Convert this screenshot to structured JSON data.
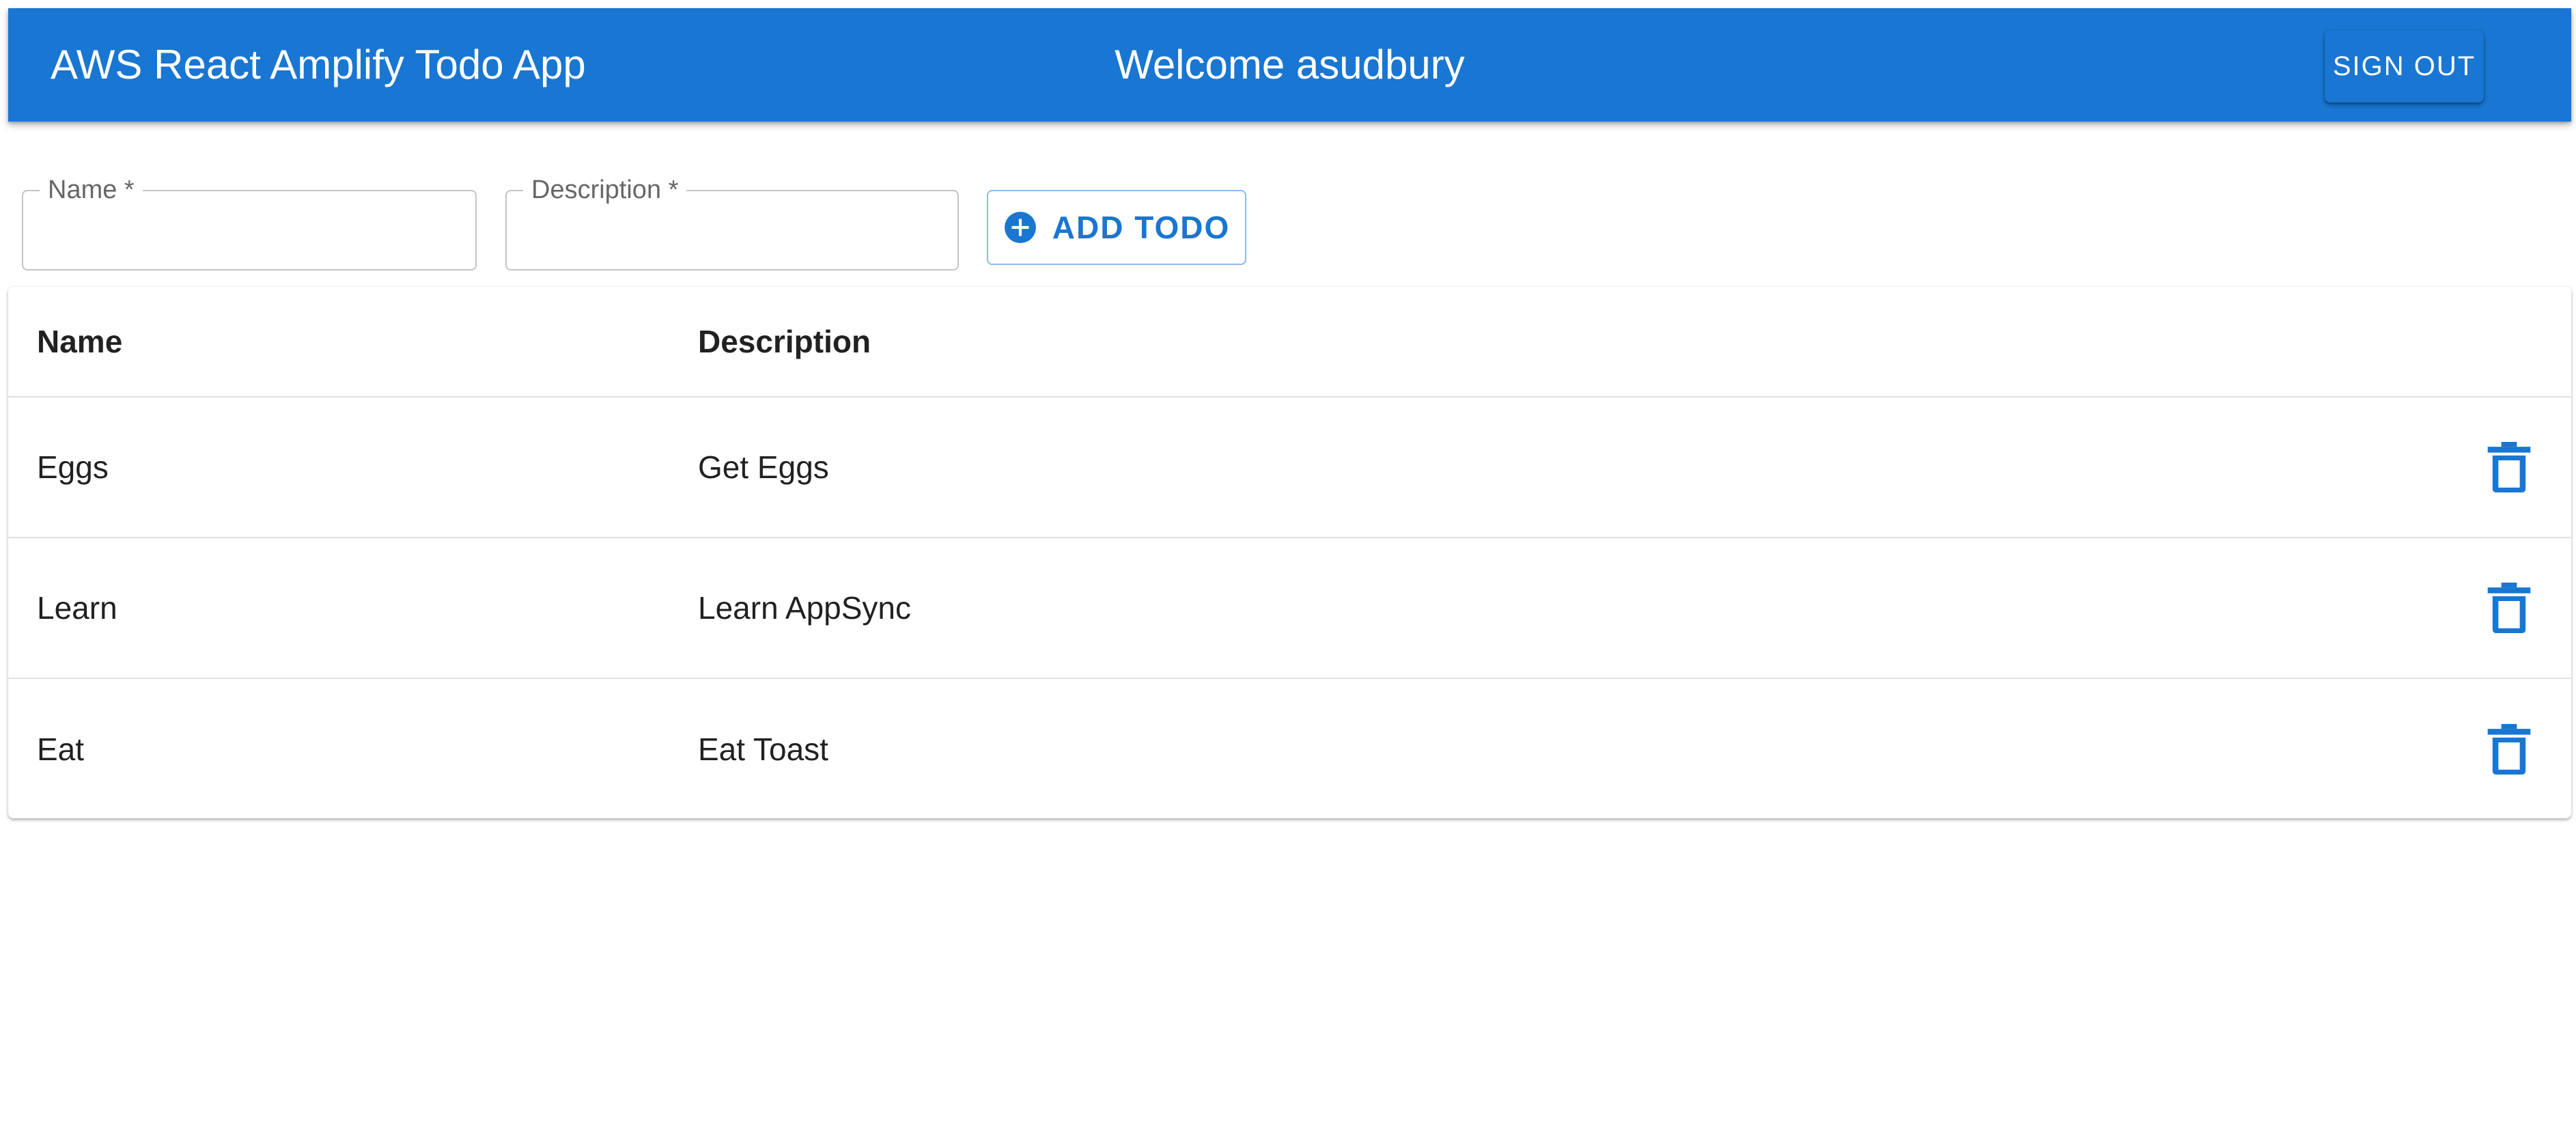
{
  "header": {
    "title": "AWS React Amplify Todo App",
    "welcome": "Welcome asudbury",
    "signout_label": "SIGN OUT"
  },
  "form": {
    "name_label": "Name *",
    "name_value": "",
    "description_label": "Description *",
    "description_value": "",
    "add_label": "ADD TODO",
    "add_icon": "add-circle-icon"
  },
  "table": {
    "headers": {
      "name": "Name",
      "description": "Description"
    },
    "rows": [
      {
        "name": "Eggs",
        "description": "Get Eggs"
      },
      {
        "name": "Learn",
        "description": "Learn AppSync"
      },
      {
        "name": "Eat",
        "description": "Eat Toast"
      }
    ],
    "row_action_icon": "delete-icon"
  },
  "colors": {
    "primary": "#1976d2",
    "text": "#212121",
    "divider": "#e0e0e0"
  }
}
